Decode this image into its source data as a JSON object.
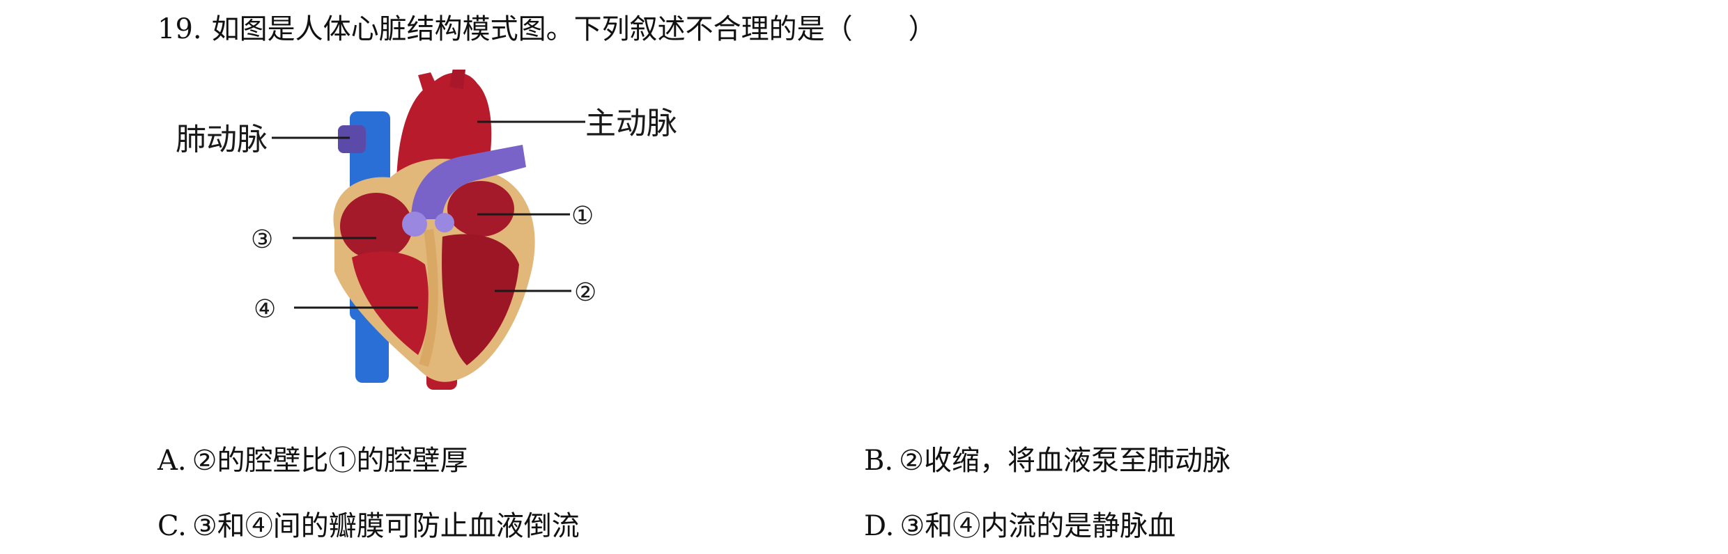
{
  "question": {
    "number": "19.",
    "text": "如图是人体心脏结构模式图。下列叙述不合理的是（　　）"
  },
  "figure": {
    "label_pulmonary_artery": "肺动脉",
    "label_aorta": "主动脉",
    "markers": [
      "①",
      "②",
      "③",
      "④"
    ]
  },
  "options": [
    {
      "letter": "A.",
      "text": "②的腔壁比①的腔壁厚"
    },
    {
      "letter": "B.",
      "text": "②收缩，将血液泵至肺动脉"
    },
    {
      "letter": "C.",
      "text": "③和④间的瓣膜可防止血液倒流"
    },
    {
      "letter": "D.",
      "text": "③和④内流的是静脉血"
    }
  ],
  "colors": {
    "heart_red": "#b81c2c",
    "heart_dark": "#7e1020",
    "vein_blue": "#2a6fd6",
    "artery_purple": "#7a63c8",
    "wall_tan": "#e2b77a"
  }
}
